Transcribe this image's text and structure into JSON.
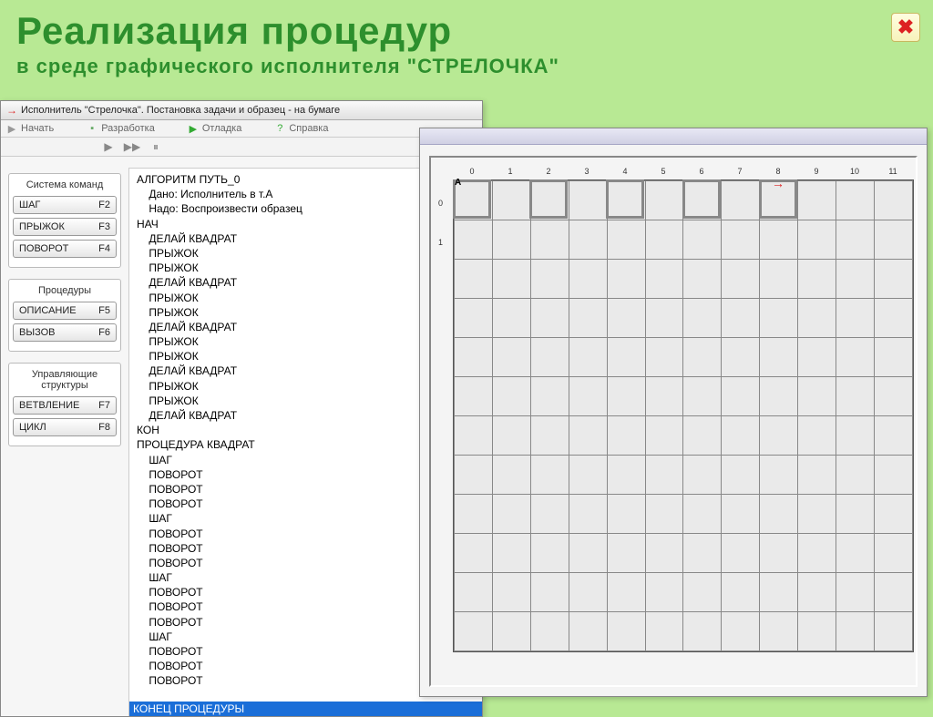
{
  "slide": {
    "title_main": "Реализация  процедур",
    "title_sub": "в  среде  графического  исполнителя  \"СТРЕЛОЧКА\""
  },
  "closeX": "✖",
  "window": {
    "title": "Исполнитель \"Стрелочка\". Постановка задачи и образец - на бумаге",
    "menu": [
      {
        "label": "Начать",
        "icon": "▶",
        "color": "#999"
      },
      {
        "label": "Разработка",
        "icon": "▪",
        "color": "#6a6"
      },
      {
        "label": "Отладка",
        "icon": "▶",
        "color": "#3a3"
      },
      {
        "label": "Справка",
        "icon": "?",
        "color": "#3a3"
      }
    ],
    "playback": [
      "▶",
      "▶▶",
      "⏸"
    ]
  },
  "cmd_panel": {
    "groups": [
      {
        "title": "Система команд",
        "buttons": [
          {
            "label": "ШАГ",
            "key": "F2"
          },
          {
            "label": "ПРЫЖОК",
            "key": "F3"
          },
          {
            "label": "ПОВОРОТ",
            "key": "F4"
          }
        ]
      },
      {
        "title": "Процедуры",
        "buttons": [
          {
            "label": "ОПИСАНИЕ",
            "key": "F5"
          },
          {
            "label": "ВЫЗОВ",
            "key": "F6"
          }
        ]
      },
      {
        "title": "Управляющие структуры",
        "buttons": [
          {
            "label": "ВЕТВЛЕНИЕ",
            "key": "F7"
          },
          {
            "label": "ЦИКЛ",
            "key": "F8"
          }
        ]
      }
    ]
  },
  "code": {
    "lines": [
      "АЛГОРИТМ ПУТЬ_0",
      "    Дано: Исполнитель в т.А",
      "    Надо: Воспроизвести образец",
      "НАЧ",
      "    ДЕЛАЙ КВАДРАТ",
      "    ПРЫЖОК",
      "    ПРЫЖОК",
      "    ДЕЛАЙ КВАДРАТ",
      "    ПРЫЖОК",
      "    ПРЫЖОК",
      "    ДЕЛАЙ КВАДРАТ",
      "    ПРЫЖОК",
      "    ПРЫЖОК",
      "    ДЕЛАЙ КВАДРАТ",
      "    ПРЫЖОК",
      "    ПРЫЖОК",
      "    ДЕЛАЙ КВАДРАТ",
      "КОН",
      "ПРОЦЕДУРА КВАДРАТ",
      "    ШАГ",
      "    ПОВОРОТ",
      "    ПОВОРОТ",
      "    ПОВОРОТ",
      "    ШАГ",
      "    ПОВОРОТ",
      "    ПОВОРОТ",
      "    ПОВОРОТ",
      "    ШАГ",
      "    ПОВОРОТ",
      "    ПОВОРОТ",
      "    ПОВОРОТ",
      "    ШАГ",
      "    ПОВОРОТ",
      "    ПОВОРОТ",
      "    ПОВОРОТ"
    ],
    "footer": "КОНЕЦ ПРОЦЕДУРЫ"
  },
  "grid": {
    "cols": [
      "0",
      "1",
      "2",
      "3",
      "4",
      "5",
      "6",
      "7",
      "8",
      "9",
      "10",
      "11"
    ],
    "rows": [
      "0",
      "1",
      "",
      "",
      "",
      "",
      "",
      "",
      "",
      "",
      "",
      ""
    ],
    "rows_count": 12,
    "cols_count": 12,
    "pointA_label": "А",
    "squares_start_cols": [
      0,
      2,
      4,
      6,
      8
    ],
    "arrow_col": 8
  }
}
